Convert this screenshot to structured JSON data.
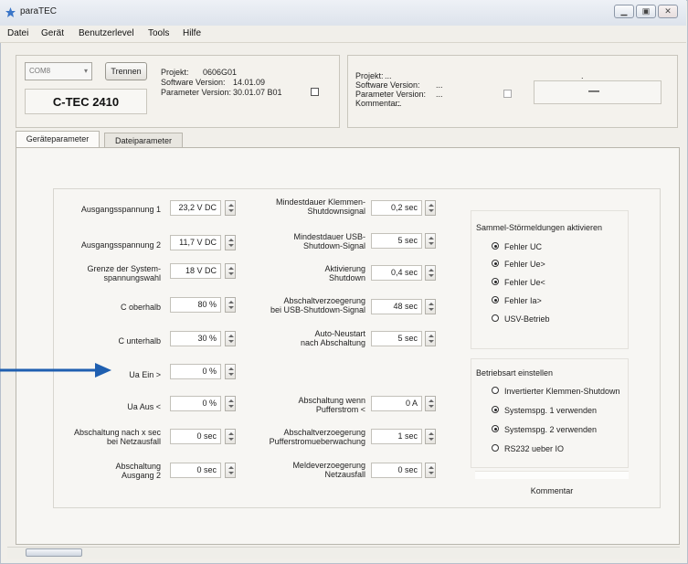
{
  "window": {
    "title": "paraTEC"
  },
  "menu": [
    "Datei",
    "Gerät",
    "Benutzerlevel",
    "Tools",
    "Hilfe"
  ],
  "device": {
    "port": "COM8",
    "disconnect_button": "Trennen",
    "device_name": "C-TEC 2410",
    "project_label": "Projekt:",
    "project_value": "0606G01",
    "software_label": "Software Version:",
    "software_value": "14.01.09",
    "parameter_label": "Parameter Version:",
    "parameter_value": "30.01.07 B01"
  },
  "file_info": {
    "project_label": "Projekt:",
    "project_value": "...",
    "software_label": "Software Version:",
    "software_value": "...",
    "parameter_label": "Parameter Version:",
    "parameter_value": "...",
    "comment_label": "Kommentar:",
    "comment_value": "...",
    "display_value": "—",
    "dots": "."
  },
  "tabs": [
    "Geräteparameter",
    "Dateiparameter"
  ],
  "params_left": [
    {
      "label": "Ausgangsspannung 1",
      "value": "23,2 V DC"
    },
    {
      "label": "Ausgangsspannung 2",
      "value": "11,7 V DC"
    },
    {
      "label": "Grenze der System-\nspannungswahl",
      "value": "18 V DC"
    },
    {
      "label": "C oberhalb",
      "value": "80 %"
    },
    {
      "label": "C unterhalb",
      "value": "30 %"
    },
    {
      "label": "Ua Ein >",
      "value": "0 %"
    },
    {
      "label": "Ua Aus <",
      "value": "0 %"
    },
    {
      "label": "Abschaltung nach x sec\nbei Netzausfall",
      "value": "0 sec"
    },
    {
      "label": "Abschaltung\nAusgang 2",
      "value": "0 sec"
    }
  ],
  "params_mid": [
    {
      "label": "Mindestdauer Klemmen-\nShutdownsignal",
      "value": "0,2 sec"
    },
    {
      "label": "Mindestdauer USB-\nShutdown-Signal",
      "value": "5 sec"
    },
    {
      "label": "Aktivierung\nShutdown",
      "value": "0,4 sec"
    },
    {
      "label": "Abschaltverzoegerung\nbei USB-Shutdown-Signal",
      "value": "48 sec"
    },
    {
      "label": "Auto-Neustart\nnach Abschaltung",
      "value": "5 sec"
    },
    {
      "label": "Abschaltung wenn\nPufferstrom <",
      "value": "0 A"
    },
    {
      "label": "Abschaltverzoegerung\nPufferstromueberwachung",
      "value": "1 sec"
    },
    {
      "label": "Meldeverzoegerung\nNetzausfall",
      "value": "0 sec"
    }
  ],
  "alarms": {
    "title": "Sammel-Störmeldungen aktivieren",
    "options": [
      {
        "label": "Fehler UC",
        "checked": true
      },
      {
        "label": "Fehler Ue>",
        "checked": true
      },
      {
        "label": "Fehler Ue<",
        "checked": true
      },
      {
        "label": "Fehler Ia>",
        "checked": true
      },
      {
        "label": "USV-Betrieb",
        "checked": false
      }
    ]
  },
  "mode": {
    "title": "Betriebsart einstellen",
    "options": [
      {
        "label": "Invertierter Klemmen-Shutdown",
        "checked": false
      },
      {
        "label": "Systemspg. 1 verwenden",
        "checked": true
      },
      {
        "label": "Systemspg. 2 verwenden",
        "checked": true
      },
      {
        "label": "RS232 ueber IO",
        "checked": false
      }
    ]
  },
  "comment_button": "Kommentar",
  "colors": {
    "arrow": "#1f5fb0",
    "titlebar": "#dde3ec",
    "background": "#f1efea"
  },
  "icons": [
    "minimize-icon",
    "maximize-icon",
    "close-icon",
    "spin-up-down-icon",
    "arrow-annotation-icon"
  ]
}
